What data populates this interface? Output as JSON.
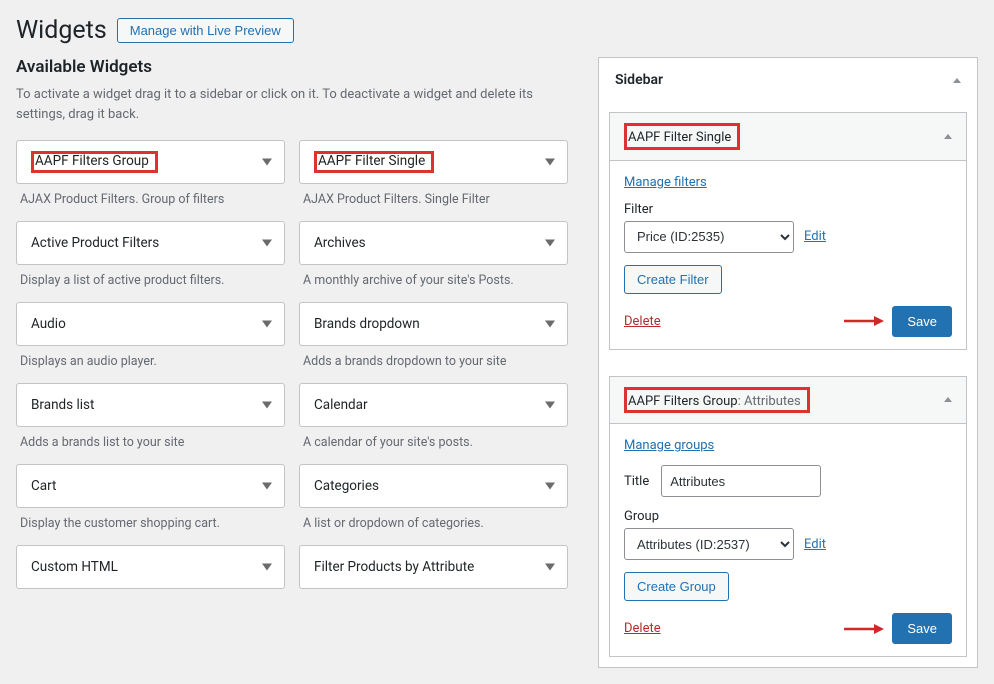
{
  "header": {
    "title": "Widgets",
    "preview_btn": "Manage with Live Preview"
  },
  "available": {
    "heading": "Available Widgets",
    "description": "To activate a widget drag it to a sidebar or click on it. To deactivate a widget and delete its settings, drag it back.",
    "items": [
      {
        "label": "AAPF Filters Group",
        "desc": "AJAX Product Filters. Group of filters",
        "highlighted": true
      },
      {
        "label": "AAPF Filter Single",
        "desc": "AJAX Product Filters. Single Filter",
        "highlighted": true
      },
      {
        "label": "Active Product Filters",
        "desc": "Display a list of active product filters."
      },
      {
        "label": "Archives",
        "desc": "A monthly archive of your site's Posts."
      },
      {
        "label": "Audio",
        "desc": "Displays an audio player."
      },
      {
        "label": "Brands dropdown",
        "desc": "Adds a brands dropdown to your site"
      },
      {
        "label": "Brands list",
        "desc": "Adds a brands list to your site"
      },
      {
        "label": "Calendar",
        "desc": "A calendar of your site's posts."
      },
      {
        "label": "Cart",
        "desc": "Display the customer shopping cart."
      },
      {
        "label": "Categories",
        "desc": "A list or dropdown of categories."
      },
      {
        "label": "Custom HTML",
        "desc": ""
      },
      {
        "label": "Filter Products by Attribute",
        "desc": ""
      }
    ]
  },
  "sidebar": {
    "title": "Sidebar",
    "widgets": [
      {
        "title": "AAPF Filter Single",
        "subtitle": "",
        "manage_link": "Manage filters",
        "filter_label": "Filter",
        "select_value": "Price (ID:2535)",
        "edit_link": "Edit",
        "create_btn": "Create Filter",
        "delete": "Delete",
        "save": "Save"
      },
      {
        "title": "AAPF Filters Group",
        "subtitle": "Attributes",
        "manage_link": "Manage groups",
        "title_label": "Title",
        "title_value": "Attributes",
        "group_label": "Group",
        "select_value": "Attributes (ID:2537)",
        "edit_link": "Edit",
        "create_btn": "Create Group",
        "delete": "Delete",
        "save": "Save"
      }
    ]
  }
}
